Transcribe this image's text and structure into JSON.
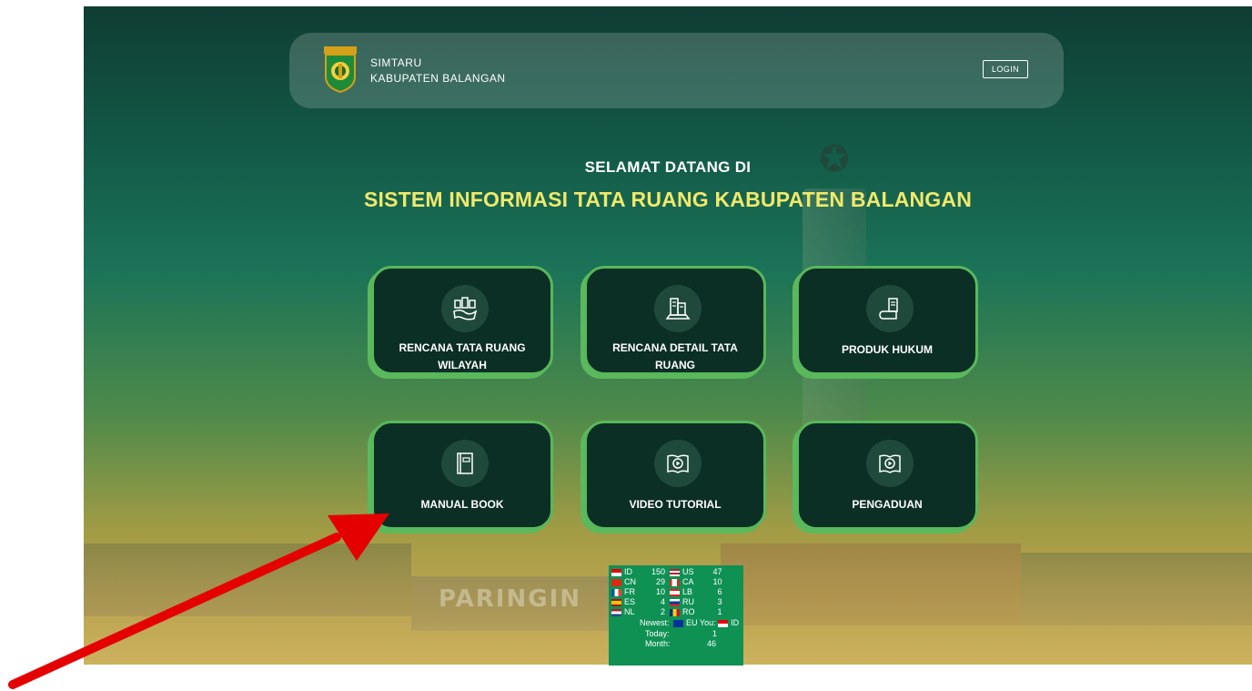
{
  "navbar": {
    "brand_line1": "SIMTARU",
    "brand_line2": "KABUPATEN BALANGAN",
    "login_label": "LOGIN"
  },
  "hero": {
    "welcome_line1": "SELAMAT DATANG DI",
    "welcome_line2": "SISTEM INFORMASI TATA RUANG KABUPATEN BALANGAN",
    "background_wall_text": "PARINGIN"
  },
  "menu_cards": [
    {
      "label": "RENCANA TATA RUANG WILAYAH",
      "icon": "city-plan-icon"
    },
    {
      "label": "RENCANA DETAIL TATA RUANG",
      "icon": "buildings-icon"
    },
    {
      "label": "PRODUK HUKUM",
      "icon": "legal-document-icon"
    },
    {
      "label": "MANUAL BOOK",
      "icon": "book-icon"
    },
    {
      "label": "VIDEO TUTORIAL",
      "icon": "video-book-icon"
    },
    {
      "label": "PENGADUAN",
      "icon": "video-book-icon"
    }
  ],
  "visitor_widget": {
    "left_col": [
      {
        "code": "ID",
        "count": "150"
      },
      {
        "code": "CN",
        "count": "29"
      },
      {
        "code": "FR",
        "count": "10"
      },
      {
        "code": "ES",
        "count": "4"
      },
      {
        "code": "NL",
        "count": "2"
      }
    ],
    "right_col": [
      {
        "code": "US",
        "count": "47"
      },
      {
        "code": "CA",
        "count": "10"
      },
      {
        "code": "LB",
        "count": "6"
      },
      {
        "code": "RU",
        "count": "3"
      },
      {
        "code": "RO",
        "count": "1"
      }
    ],
    "newest_label": "Newest:",
    "newest_value": "EU",
    "you_label": "You:",
    "you_value": "ID",
    "today_label": "Today:",
    "today_value": "1",
    "month_label": "Month:",
    "month_value": "46"
  },
  "colors": {
    "card_bg": "#0b2e25",
    "card_border": "#58b85a",
    "welcome_highlight": "#f1e86a",
    "widget_bg": "#0f9154",
    "arrow": "#e50000"
  }
}
